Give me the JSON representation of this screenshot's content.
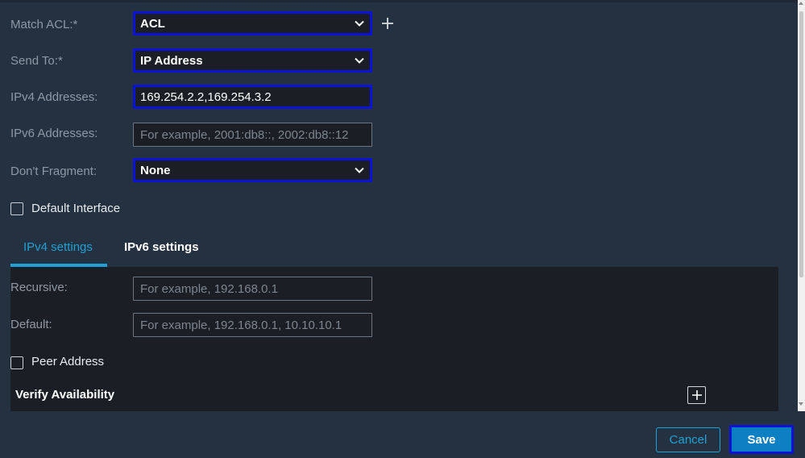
{
  "form": {
    "match_acl": {
      "label": "Match ACL:*",
      "value": "ACL"
    },
    "send_to": {
      "label": "Send To:*",
      "value": "IP Address"
    },
    "ipv4_addresses": {
      "label": "IPv4 Addresses:",
      "value": "169.254.2.2,169.254.3.2"
    },
    "ipv6_addresses": {
      "label": "IPv6 Addresses:",
      "placeholder": "For example, 2001:db8::, 2002:db8::12"
    },
    "dont_fragment": {
      "label": "Don't Fragment:",
      "value": "None"
    },
    "default_interface": {
      "label": "Default Interface",
      "checked": false
    }
  },
  "tabs": [
    {
      "label": "IPv4 settings",
      "active": true
    },
    {
      "label": "IPv6 settings",
      "active": false
    }
  ],
  "ipv4_panel": {
    "recursive": {
      "label": "Recursive:",
      "placeholder": "For example, 192.168.0.1"
    },
    "default": {
      "label": "Default:",
      "placeholder": "For example, 192.168.0.1, 10.10.10.1"
    },
    "peer_address": {
      "label": "Peer Address",
      "checked": false
    },
    "verify_availability": {
      "label": "Verify Availability"
    }
  },
  "footer": {
    "cancel_label": "Cancel",
    "save_label": "Save"
  },
  "colors": {
    "background": "#243140",
    "field_bg": "#1b1f25",
    "focus_border": "#0b13d8",
    "accent": "#1fa0d6",
    "save_bg": "#0d80c4"
  },
  "icons": [
    "add-icon",
    "chevron-down-icon",
    "checkbox-icon",
    "scrollbar"
  ]
}
